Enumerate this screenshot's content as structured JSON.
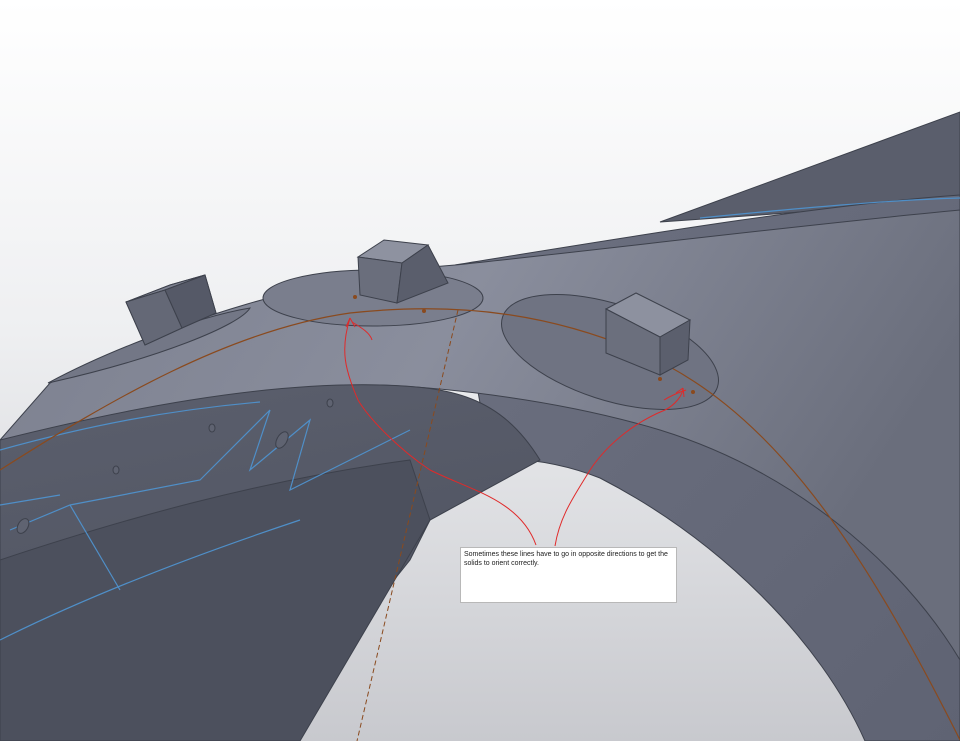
{
  "annotation": {
    "text": "Sometimes these lines have to go in opposite directions to get the solids to orient correctly."
  },
  "colors": {
    "background_top": "#ffffff",
    "background_bottom": "#c8c9ce",
    "part_face": "#6d7180",
    "part_edge": "#3d414c",
    "path_curve": "#8a4a1e",
    "sketch_lines": "#e02a2a",
    "highlight_edges": "#4f8fc8"
  },
  "scene": {
    "objects": [
      {
        "name": "curved-arch-part"
      },
      {
        "name": "sweep-path-curve"
      },
      {
        "name": "ellipse-profile-left"
      },
      {
        "name": "ellipse-profile-middle"
      },
      {
        "name": "ellipse-profile-right"
      },
      {
        "name": "cube-solid-left"
      },
      {
        "name": "cube-solid-middle"
      },
      {
        "name": "cube-solid-right"
      }
    ]
  }
}
